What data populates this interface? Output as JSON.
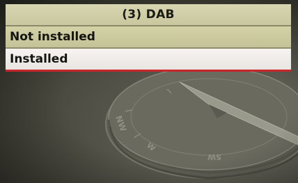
{
  "header": {
    "title": "(3) DAB"
  },
  "menu": {
    "items": [
      {
        "label": "Not installed",
        "selected": false
      },
      {
        "label": "Installed",
        "selected": true
      }
    ]
  },
  "background": {
    "compass_labels": [
      "NW",
      "W",
      "SW"
    ],
    "icon": "compass-icon"
  },
  "colors": {
    "header_bg": "#d0ceA4",
    "selected_bg": "#f2efeb",
    "selection_underline": "#c8262a",
    "background": "#4a4a41"
  }
}
